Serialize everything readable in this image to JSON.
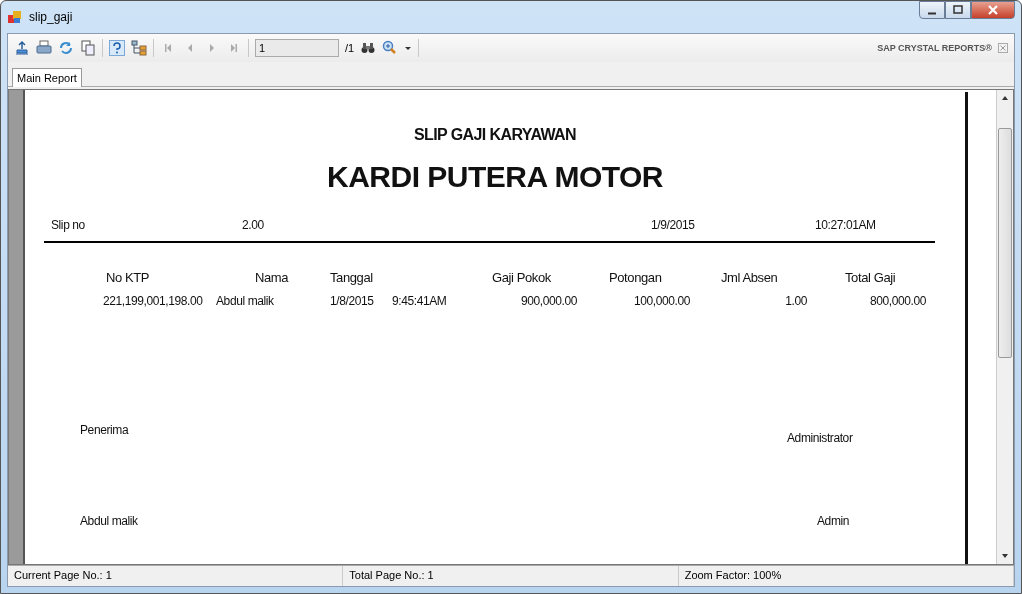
{
  "window": {
    "title": "slip_gaji"
  },
  "toolbar": {
    "page_field": "1",
    "page_count": "/1",
    "brand": "SAP CRYSTAL REPORTS®"
  },
  "tabs": [
    {
      "label": "Main Report",
      "selected": true
    }
  ],
  "report": {
    "title": "SLIP GAJI KARYAWAN",
    "company": "KARDI PUTERA MOTOR",
    "header": {
      "slip_label": "Slip no",
      "slip_no": "2.00",
      "date": "1/9/2015",
      "time": "10:27:01AM"
    },
    "columns": [
      "No KTP",
      "Nama",
      "Tanggal",
      "Gaji Pokok",
      "Potongan",
      "Jml Absen",
      "Total Gaji"
    ],
    "rows": [
      {
        "no_ktp": "221,199,001,198.00",
        "nama": "Abdul malik",
        "tanggal": "1/8/2015",
        "jam": "9:45:41AM",
        "gaji_pokok": "900,000.00",
        "potongan": "100,000.00",
        "jml_absen": "1.00",
        "total_gaji": "800,000.00"
      }
    ],
    "signatures": {
      "receiver_label": "Penerima",
      "admin_label": "Administrator",
      "receiver_name": "Abdul malik",
      "admin_name": "Admin"
    }
  },
  "status_bar": [
    "Current Page No.: 1",
    "Total Page No.: 1",
    "Zoom Factor: 100%"
  ]
}
